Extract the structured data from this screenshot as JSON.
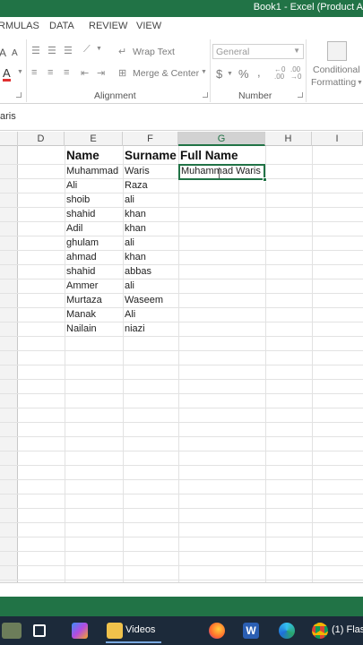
{
  "window": {
    "title": "Book1 -  Excel (Product A"
  },
  "ribbon_tabs": [
    "RMULAS",
    "DATA",
    "REVIEW",
    "VIEW"
  ],
  "ribbon": {
    "wrap_text": "Wrap Text",
    "merge_center": "Merge & Center",
    "number_format": "General",
    "currency_symbol": "$",
    "percent_symbol": "%",
    "comma_symbol": ",",
    "conditional_formatting_line1": "Conditional",
    "conditional_formatting_line2": "Formatting",
    "group_alignment": "Alignment",
    "group_number": "Number",
    "font_size_up": "A",
    "font_size_down": "A",
    "font_color": "A"
  },
  "formula_bar": {
    "content": "aris"
  },
  "columns": [
    "D",
    "E",
    "F",
    "G",
    "H",
    "I"
  ],
  "active_column": "G",
  "sheet": {
    "header": {
      "name": "Name",
      "surname": "Surname",
      "full_name": "Full Name"
    },
    "rows": [
      {
        "name": "Muhammad",
        "surname": "Waris",
        "full": "Muhammad Waris"
      },
      {
        "name": "Ali",
        "surname": "Raza",
        "full": ""
      },
      {
        "name": "shoib",
        "surname": "ali",
        "full": ""
      },
      {
        "name": "shahid",
        "surname": "khan",
        "full": ""
      },
      {
        "name": "Adil",
        "surname": "khan",
        "full": ""
      },
      {
        "name": "ghulam",
        "surname": "ali",
        "full": ""
      },
      {
        "name": "ahmad",
        "surname": "khan",
        "full": ""
      },
      {
        "name": "shahid",
        "surname": "abbas",
        "full": ""
      },
      {
        "name": "Ammer",
        "surname": "ali",
        "full": ""
      },
      {
        "name": "Murtaza",
        "surname": "Waseem",
        "full": ""
      },
      {
        "name": "Manak",
        "surname": "Ali",
        "full": ""
      },
      {
        "name": "Nailain",
        "surname": "niazi",
        "full": ""
      }
    ]
  },
  "taskbar": {
    "items": [
      {
        "icon": "start-icon"
      },
      {
        "icon": "task-view-icon"
      },
      {
        "icon": "copilot-icon"
      },
      {
        "icon": "folder-icon",
        "label": "Videos"
      },
      {
        "icon": "firefox-icon"
      },
      {
        "icon": "word-icon"
      },
      {
        "icon": "edge-icon"
      },
      {
        "icon": "chrome-icon",
        "label": "(1) Flas"
      }
    ]
  },
  "colors": {
    "excel_green": "#217346",
    "taskbar_bg": "#1c2a3a",
    "selection_border": "#217346"
  }
}
